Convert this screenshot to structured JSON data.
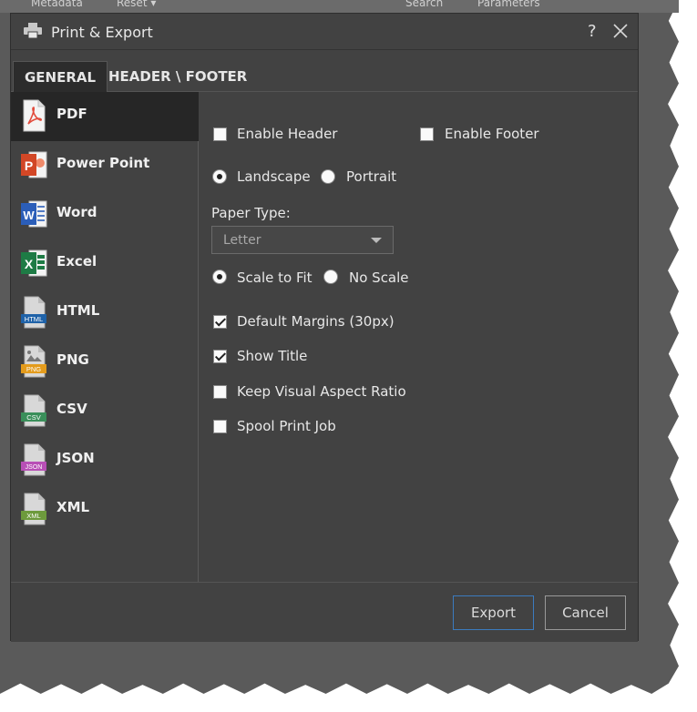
{
  "background": {
    "topbar_items": [
      "Metadata",
      "Reset ▾",
      "Search",
      "Parameters"
    ]
  },
  "dialog": {
    "title": "Print & Export",
    "help_label": "?"
  },
  "tabs": [
    {
      "label": "GENERAL",
      "active": true
    },
    {
      "label": "HEADER \\ FOOTER",
      "active": false
    }
  ],
  "formats": [
    {
      "label": "PDF",
      "icon": "pdf-file-icon",
      "active": true
    },
    {
      "label": "Power Point",
      "icon": "powerpoint-file-icon"
    },
    {
      "label": "Word",
      "icon": "word-file-icon"
    },
    {
      "label": "Excel",
      "icon": "excel-file-icon"
    },
    {
      "label": "HTML",
      "icon": "html-file-icon",
      "badge": "HTML"
    },
    {
      "label": "PNG",
      "icon": "png-file-icon",
      "badge": "PNG"
    },
    {
      "label": "CSV",
      "icon": "csv-file-icon",
      "badge": "CSV"
    },
    {
      "label": "JSON",
      "icon": "json-file-icon",
      "badge": "JSON"
    },
    {
      "label": "XML",
      "icon": "xml-file-icon",
      "badge": "XML"
    }
  ],
  "options": {
    "enable_header": {
      "label": "Enable Header",
      "checked": false
    },
    "enable_footer": {
      "label": "Enable Footer",
      "checked": false
    },
    "orientation": {
      "landscape": "Landscape",
      "portrait": "Portrait",
      "selected": "landscape"
    },
    "paper_type": {
      "label": "Paper Type:",
      "value": "Letter"
    },
    "scaling": {
      "scale_to_fit": "Scale to Fit",
      "no_scale": "No Scale",
      "selected": "scale_to_fit"
    },
    "default_margins": {
      "label": "Default Margins (30px)",
      "checked": true
    },
    "show_title": {
      "label": "Show Title",
      "checked": true
    },
    "keep_aspect": {
      "label": "Keep Visual Aspect Ratio",
      "checked": false
    },
    "spool_print": {
      "label": "Spool Print Job",
      "checked": false
    }
  },
  "buttons": {
    "export": "Export",
    "cancel": "Cancel"
  },
  "colors": {
    "pdf": "#e24b3c",
    "powerpoint": "#d24726",
    "word": "#2b5eb9",
    "excel": "#1e7b45",
    "html": "#1f62a8",
    "png": "#e39b1c",
    "csv": "#3a8f5a",
    "json": "#b84fb6",
    "xml": "#6d9a3c",
    "primary_border": "#3b7bbf"
  }
}
